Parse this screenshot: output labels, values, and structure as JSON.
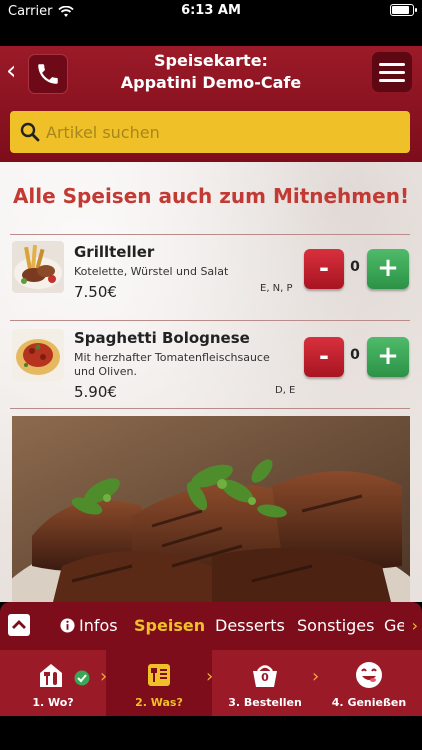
{
  "status": {
    "carrier": "Carrier",
    "time": "6:13 AM"
  },
  "header": {
    "title_line1": "Speisekarte:",
    "title_line2": "Appatini Demo-Cafe"
  },
  "search": {
    "placeholder": "Artikel suchen"
  },
  "promo": "Alle Speisen auch zum Mitnehmen!",
  "items": [
    {
      "name": "Grillteller",
      "description": "Kotelette, Würstel und Salat",
      "price": "7.50€",
      "allergens": "E, N, P",
      "minus": "-",
      "qty": "0",
      "plus": "+"
    },
    {
      "name": "Spaghetti Bolognese",
      "description": "Mit herzhafter Tomatenfleischsauce und Oliven.",
      "price": "5.90€",
      "allergens": "D, E",
      "minus": "-",
      "qty": "0",
      "plus": "+"
    }
  ],
  "tabs": [
    {
      "label": "Infos",
      "icon": "info-icon"
    },
    {
      "label": "Speisen",
      "active": true
    },
    {
      "label": "Desserts"
    },
    {
      "label": "Sonstiges"
    },
    {
      "label": "Ge"
    }
  ],
  "steps": [
    {
      "label": "1. Wo?",
      "icon": "restaurant-icon"
    },
    {
      "label": "2. Was?",
      "icon": "menu-icon",
      "active": true
    },
    {
      "label": "3. Bestellen",
      "icon": "basket-icon",
      "badge": "0"
    },
    {
      "label": "4. Genießen",
      "icon": "smiley-icon"
    }
  ],
  "colors": {
    "primary": "#9b1a28",
    "dark": "#7d0d1b",
    "accent": "#f0c028",
    "minus": "#c11f2c",
    "plus": "#3aa656"
  }
}
